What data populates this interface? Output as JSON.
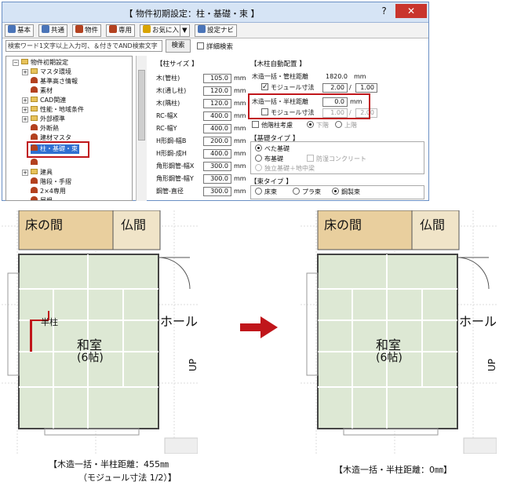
{
  "window": {
    "title": "【 物件初期設定：柱・基礎・束 】",
    "help": "?",
    "close": "✕"
  },
  "toolbar": {
    "items": [
      {
        "label": "基本",
        "color": "#4a74b8"
      },
      {
        "label": "共通",
        "color": "#4a74b8"
      },
      {
        "label": "物件",
        "color": "#b3411f"
      },
      {
        "label": "専用",
        "color": "#b3411f"
      },
      {
        "label": "お気に入り",
        "color": "#d9a400"
      },
      {
        "label": "▼",
        "color": ""
      },
      {
        "label": "設定ナビ",
        "color": "#4a74b8"
      }
    ]
  },
  "search": {
    "placeholder": "検索ワード1文字以上入力可、＆付きでAND検索文字",
    "button": "検索",
    "detail_label": "詳細検索"
  },
  "tree": {
    "items": [
      {
        "label": "物件初期設定",
        "type": "folder",
        "expand": "−"
      },
      {
        "label": "マスタ環境",
        "type": "folder",
        "expand": "+"
      },
      {
        "label": "基準高さ情報",
        "type": "item",
        "expand": ""
      },
      {
        "label": "素材",
        "type": "item",
        "expand": ""
      },
      {
        "label": "CAD関連",
        "type": "folder",
        "expand": "+"
      },
      {
        "label": "性能・地域条件",
        "type": "folder",
        "expand": "+"
      },
      {
        "label": "外部標準",
        "type": "folder",
        "expand": "+"
      },
      {
        "label": "外断熱",
        "type": "item",
        "expand": ""
      },
      {
        "label": "建材マスタ",
        "type": "item",
        "expand": ""
      },
      {
        "label": "柱・基礎・束",
        "type": "item",
        "expand": "",
        "selected": true
      },
      {
        "label": "",
        "type": "item",
        "expand": ""
      },
      {
        "label": "建具",
        "type": "folder",
        "expand": "+"
      },
      {
        "label": "階段・手摺",
        "type": "item",
        "expand": ""
      },
      {
        "label": "2×4専用",
        "type": "item",
        "expand": ""
      },
      {
        "label": "屋根",
        "type": "item",
        "expand": ""
      }
    ]
  },
  "column_size": {
    "title": "【柱サイズ 】",
    "unit": "mm",
    "rows": [
      {
        "label": "木(管柱)",
        "value": "105.0"
      },
      {
        "label": "木(通し柱)",
        "value": "120.0"
      },
      {
        "label": "木(隅柱)",
        "value": "120.0"
      },
      {
        "label": "RC-幅X",
        "value": "400.0"
      },
      {
        "label": "RC-幅Y",
        "value": "400.0"
      },
      {
        "label": "H形鋼-幅B",
        "value": "200.0"
      },
      {
        "label": "H形鋼-成H",
        "value": "400.0"
      },
      {
        "label": "角形鋼管-幅X",
        "value": "300.0"
      },
      {
        "label": "角形鋼管-幅Y",
        "value": "300.0"
      },
      {
        "label": "鋼管-直径",
        "value": "300.0"
      }
    ]
  },
  "auto_column": {
    "title": "【木柱自動配置 】",
    "distance_label": "木造一括・管柱距離",
    "distance_value": "1820.0",
    "module_label": "モジュール寸法",
    "module_checked": true,
    "module_num": "2.00",
    "module_den": "1.00",
    "half_label": "木造一括・半柱距離",
    "half_value": "0.0",
    "half_module_label": "モジュール寸法",
    "half_module_checked": false,
    "half_num": "1.00",
    "half_den": "2.00",
    "unit": "mm",
    "slash": "/",
    "other_floor_label": "他階柱考慮",
    "lower": "下階",
    "upper": "上階"
  },
  "foundation": {
    "title": "【基礎タイプ 】",
    "options": [
      {
        "label": "べた基礎",
        "selected": true,
        "enabled": true
      },
      {
        "label": "布基礎",
        "selected": false,
        "enabled": true
      },
      {
        "label": "防湿コンクリート",
        "selected": false,
        "enabled": false
      },
      {
        "label": "独立基礎＋地中梁",
        "selected": false,
        "enabled": false
      }
    ]
  },
  "tsuka": {
    "title": "【束タイプ 】",
    "options": [
      {
        "label": "床束",
        "selected": false
      },
      {
        "label": "プラ束",
        "selected": false
      },
      {
        "label": "鋼製束",
        "selected": true
      }
    ]
  },
  "plan_left": {
    "room_tokonoma": "床の間",
    "room_butsuma": "仏間",
    "room_washitsu": "和室",
    "room_size": "(6帖)",
    "hall": "ホール",
    "up": "UP",
    "half_column": "半柱",
    "caption1": "【木造一括・半柱距離：455㎜",
    "caption2": "（モジュール寸法 1/2）】"
  },
  "plan_right": {
    "room_tokonoma": "床の間",
    "room_butsuma": "仏間",
    "room_washitsu": "和室",
    "room_size": "(6帖)",
    "hall": "ホール",
    "up": "UP",
    "caption1": "【木造一括・半柱距離：0㎜】"
  },
  "colors": {
    "highlight": "#c0161b",
    "tatami": "#dde8d4",
    "wood": "#e9cf9e",
    "arrow": "#c0161b"
  }
}
